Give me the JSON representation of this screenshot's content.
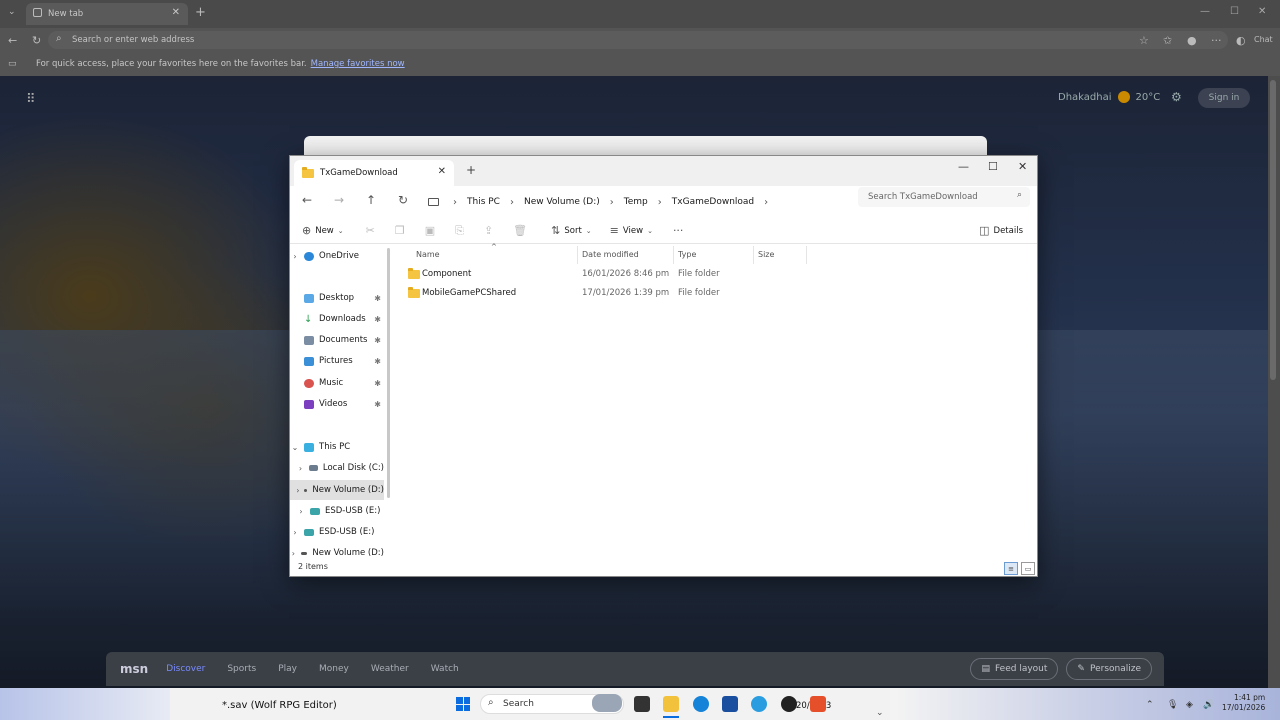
{
  "browser": {
    "tab_title": "New tab",
    "address_placeholder": "Search or enter web address",
    "favbar_text": "For quick access, place your favorites here on the favorites bar.",
    "favbar_link": "Manage favorites now",
    "copilot_label": "Chat"
  },
  "newtab": {
    "location": "Dhakadhai",
    "temperature": "20°C",
    "signin_label": "Sign in"
  },
  "msn": {
    "logo": "msn",
    "nav": [
      "Discover",
      "Sports",
      "Play",
      "Money",
      "Weather",
      "Watch"
    ],
    "feed_layout_label": "Feed layout",
    "personalize_label": "Personalize"
  },
  "explorer": {
    "tab_title": "TxGameDownload",
    "breadcrumbs": [
      "This PC",
      "New Volume (D:)",
      "Temp",
      "TxGameDownload"
    ],
    "search_placeholder": "Search TxGameDownload",
    "commands": {
      "new": "New",
      "sort": "Sort",
      "view": "View",
      "details": "Details"
    },
    "sidebar": {
      "onedrive": "OneDrive",
      "desktop": "Desktop",
      "downloads": "Downloads",
      "documents": "Documents",
      "pictures": "Pictures",
      "music": "Music",
      "videos": "Videos",
      "thispc": "This PC",
      "localdisk": "Local Disk (C:)",
      "newvolume": "New Volume (D:)",
      "esd1": "ESD-USB (E:)",
      "esd2": "ESD-USB (E:)",
      "newvolume2": "New Volume (D:)"
    },
    "columns": {
      "name": "Name",
      "date": "Date modified",
      "type": "Type",
      "size": "Size"
    },
    "rows": [
      {
        "name": "Component",
        "date": "16/01/2026 8:46 pm",
        "type": "File folder",
        "size": ""
      },
      {
        "name": "MobileGamePCShared",
        "date": "17/01/2026 1:39 pm",
        "type": "File folder",
        "size": ""
      }
    ],
    "status": "2 items"
  },
  "taskbar": {
    "window_title": "*.sav (Wolf RPG Editor)",
    "search_label": "Search",
    "time": "1:41 pm",
    "date": "17/01/2026",
    "overlay_date": "20/2023"
  }
}
